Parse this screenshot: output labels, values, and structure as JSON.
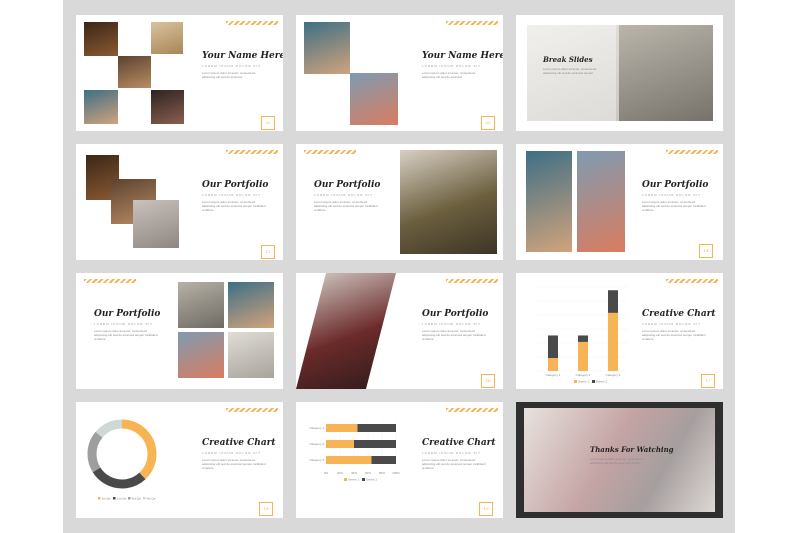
{
  "slides": {
    "s1": {
      "title": "Your Name Here",
      "subtitle": "LOREM IPSUM DOLOR SIT",
      "body": "Lorem ipsum dolor sit amet, consectetur adipiscing elit sed do eiusmod",
      "page": "02"
    },
    "s2": {
      "title": "Your Name Here",
      "subtitle": "LOREM IPSUM DOLOR SIT",
      "body": "Lorem ipsum dolor sit amet, consectetur adipiscing elit sed do eiusmod",
      "page": "03"
    },
    "s3": {
      "title": "Break Slides",
      "body": "Lorem ipsum dolor sit amet, consectetur adipiscing elit sed do eiusmod tempor"
    },
    "s4": {
      "title": "Our Portfolio",
      "subtitle": "LOREM IPSUM DOLOR SIT",
      "body": "Lorem ipsum dolor sit amet, consectetur adipiscing elit sed do eiusmod tempor incididunt ut labore",
      "page": "12"
    },
    "s5": {
      "title": "Our Portfolio",
      "subtitle": "LOREM IPSUM DOLOR SIT",
      "body": "Lorem ipsum dolor sit amet, consectetur adipiscing elit sed do eiusmod tempor incididunt ut labore"
    },
    "s6": {
      "title": "Our Portfolio",
      "subtitle": "LOREM IPSUM DOLOR SIT",
      "body": "Lorem ipsum dolor sit amet, consectetur adipiscing elit sed do eiusmod tempor incididunt ut labore",
      "page": "14"
    },
    "s7": {
      "title": "Our Portfolio",
      "subtitle": "LOREM IPSUM DOLOR SIT",
      "body": "Lorem ipsum dolor sit amet, consectetur adipiscing elit sed do eiusmod tempor incididunt ut labore"
    },
    "s8": {
      "title": "Our Portfolio",
      "subtitle": "LOREM IPSUM DOLOR SIT",
      "body": "Lorem ipsum dolor sit amet, consectetur adipiscing elit sed do eiusmod tempor incididunt ut labore",
      "page": "16"
    },
    "s9": {
      "title": "Creative Chart",
      "subtitle": "LOREM IPSUM DOLOR SIT",
      "body": "Lorem ipsum dolor sit amet, consectetur adipiscing elit sed do eiusmod tempor incididunt ut labore",
      "page": "17"
    },
    "s10": {
      "title": "Creative Chart",
      "subtitle": "LOREM IPSUM DOLOR SIT",
      "body": "Lorem ipsum dolor sit amet, consectetur adipiscing elit sed do eiusmod tempor incididunt ut labore",
      "page": "18"
    },
    "s11": {
      "title": "Creative Chart",
      "subtitle": "LOREM IPSUM DOLOR SIT",
      "body": "Lorem ipsum dolor sit amet, consectetur adipiscing elit sed do eiusmod tempor incididunt ut labore",
      "page": "19"
    },
    "s12": {
      "title": "Thanks For Watching",
      "body": "Lorem ipsum dolor sit amet, consectetur adipiscing elit sed do eiusmod tempor"
    }
  },
  "colors": {
    "accent": "#f6b454",
    "dark": "#4a4a4a",
    "grey": "#bdbdbd",
    "board": "#d9d9d9"
  },
  "chart_data": [
    {
      "type": "bar",
      "stacked": true,
      "categories": [
        "Category 1",
        "Category 2",
        "Category 3"
      ],
      "series": [
        {
          "name": "Series 1",
          "values": [
            2,
            4.5,
            9
          ]
        },
        {
          "name": "Series 2",
          "values": [
            3.5,
            1,
            3.5
          ]
        }
      ],
      "ylim": [
        0,
        13
      ],
      "series_colors": [
        "#f6b454",
        "#4a4a4a"
      ]
    },
    {
      "type": "pie",
      "donut": true,
      "labels": [
        "1st Qtr",
        "2nd Qtr",
        "3rd Qtr",
        "4th Qtr"
      ],
      "values": [
        38,
        28,
        20,
        14
      ],
      "slice_colors": [
        "#f6b454",
        "#4a4a4a",
        "#9e9e9e",
        "#cfd8d3"
      ]
    },
    {
      "type": "bar",
      "orientation": "horizontal",
      "stacked": true,
      "categories": [
        "Category 1",
        "Category 2",
        "Category 3"
      ],
      "series": [
        {
          "name": "Series 1",
          "values": [
            45,
            40,
            65
          ]
        },
        {
          "name": "Series 2",
          "values": [
            55,
            60,
            35
          ]
        }
      ],
      "xticks": [
        "0%",
        "20%",
        "40%",
        "60%",
        "80%",
        "100%"
      ],
      "series_colors": [
        "#f6b454",
        "#4a4a4a"
      ]
    }
  ]
}
